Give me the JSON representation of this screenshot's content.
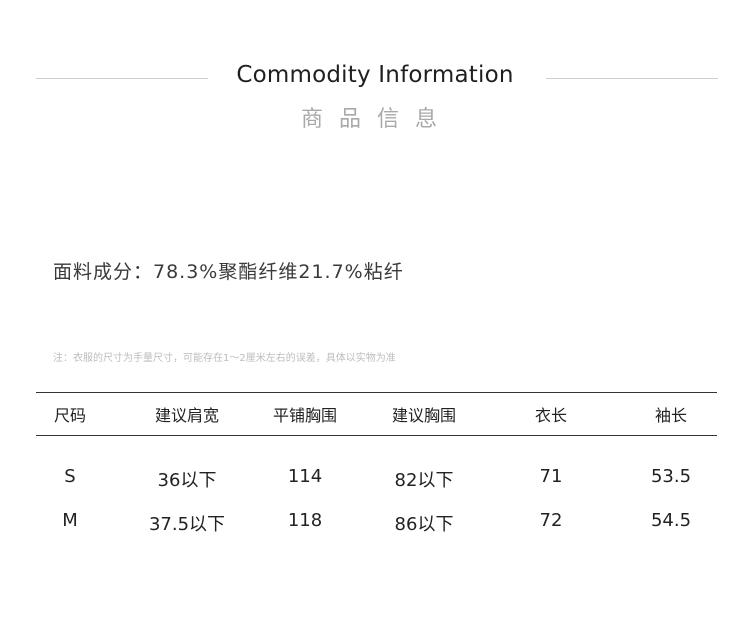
{
  "header": {
    "title_en": "Commodity Information",
    "title_cn": "商品信息"
  },
  "fabric_text": "面料成分：78.3%聚酯纤维21.7%粘纤",
  "note_text": "注：衣服的尺寸为手量尺寸，可能存在1～2厘米左右的误差，具体以实物为准",
  "size_table": {
    "columns": [
      "尺码",
      "建议肩宽",
      "平铺胸围",
      "建议胸围",
      "衣长",
      "袖长"
    ],
    "rows": [
      [
        "S",
        "36以下",
        "114",
        "82以下",
        "71",
        "53.5"
      ],
      [
        "M",
        "37.5以下",
        "118",
        "86以下",
        "72",
        "54.5"
      ]
    ]
  }
}
